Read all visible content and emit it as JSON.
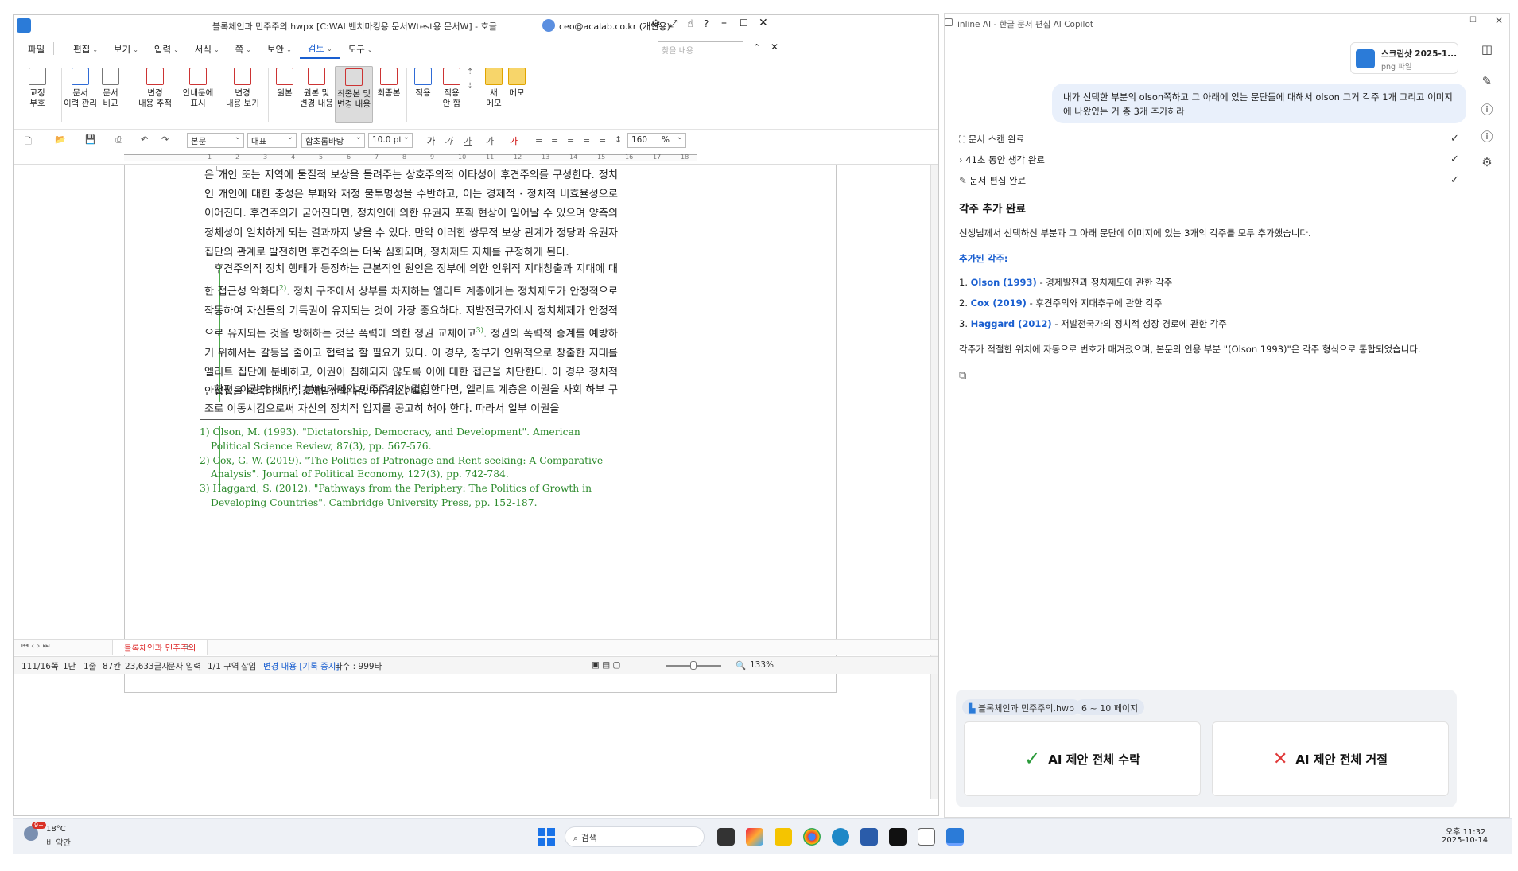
{
  "hwp": {
    "title": "블록체인과 민주주의.hwpx [C:WAI 벤치마킹용 문서Wtest용 문서W] - 호글",
    "account": "ceo@acalab.co.kr (개인용)",
    "menus": [
      "파일",
      "편집",
      "보기",
      "입력",
      "서식",
      "쪽",
      "보안",
      "검토",
      "도구"
    ],
    "active_menu": "검토",
    "search_placeholder": "찾을 내용",
    "ribbon": [
      {
        "l1": "교정",
        "l2": "부호"
      },
      {
        "l1": "문서",
        "l2": "이력 관리"
      },
      {
        "l1": "문서",
        "l2": "비교"
      },
      {
        "l1": "변경",
        "l2": "내용 추적"
      },
      {
        "l1": "안내문에",
        "l2": "표시"
      },
      {
        "l1": "변경",
        "l2": "내용 보기"
      },
      {
        "l1": "원본",
        "l2": ""
      },
      {
        "l1": "원본 및",
        "l2": "변경 내용"
      },
      {
        "l1": "최종본 및",
        "l2": "변경 내용"
      },
      {
        "l1": "최종본",
        "l2": ""
      },
      {
        "l1": "적용",
        "l2": ""
      },
      {
        "l1": "적용",
        "l2": "안 함"
      },
      {
        "l1": "새",
        "l2": "메모"
      },
      {
        "l1": "메모",
        "l2": ""
      }
    ],
    "format": {
      "style": "본문",
      "lang": "대표",
      "font": "함초롬바탕",
      "size": "10.0",
      "unit": "pt",
      "zoom": "160",
      "zoom_unit": "%"
    },
    "ruler_ticks": [
      "1",
      "2",
      "3",
      "4",
      "5",
      "6",
      "7",
      "8",
      "9",
      "10",
      "11",
      "12",
      "13",
      "14",
      "15",
      "16",
      "17",
      "18"
    ],
    "paragraphs": [
      "은 개인 또는 지역에 물질적 보상을 돌려주는 상호주의적 이타성이 후견주의를 구성한다. 정치인 개인에 대한 충성은 부패와 재정 불투명성을 수반하고, 이는 경제적 · 정치적 비효율성으로 이어진다. 후견주의가 굳어진다면, 정치인에 의한 유권자 포획 현상이 일어날 수 있으며 양측의 정체성이 일치하게 되는 결과까지 낳을 수 있다. 만약 이러한 쌍무적 보상 관계가 정당과 유권자 집단의 관계로 발전하면 후견주의는 더욱 심화되며, 정치제도 자체를 규정하게 된다.",
      "후견주의적 정치 행태가 등장하는 근본적인 원인은 정부에 의한 인위적 지대창출과 지대에 대한 접근성 악화다",
      ". 정치 구조에서 상부를 차지하는 엘리트 계층에게는 정치제도가 안정적으로 작동하여 자신들의 기득권이 유지되는 것이 가장 중요하다. 저발전국가에서 정치체제가 안정적으로 유지되는 것을 방해하는 것은 폭력에 의한 정권 교체이고",
      ". 정권의 폭력적 승계를 예방하기 위해서는 갈등을 줄이고 협력을 할 필요가 있다. 이 경우, 정부가 인위적으로 창출한 지대를 엘리트 집단에 분배하고, 이권이 침해되지 않도록 이에 대한 접근을 차단한다. 이 경우 정치적 안정성을 획득하지만, 경제발전의 유인이 감소한다.",
      "한편, 이권의 배타적 분배 기제와 민주주의가 결합한다면, 엘리트 계층은 이권을 사회 하부 구조로 이동시킴으로써 자신의 정치적 입지를 공고히 해야 한다. 따라서 일부 이권을"
    ],
    "sup2": "2)",
    "sup3": "3)",
    "footnotes": [
      "1) Olson, M. (1993). \"Dictatorship, Democracy, and Development\". American Political Science Review, 87(3), pp. 567-576.",
      "2) Cox, G. W. (2019). \"The Politics of Patronage and Rent-seeking: A Comparative Analysis\". Journal of Political Economy, 127(3), pp. 742-784.",
      "3) Haggard, S. (2012). \"Pathways from the Periphery: The Politics of Growth in Developing Countries\". Cambridge University Press, pp. 152-187."
    ],
    "doc_tab": "블록체인과 민주주의",
    "status": [
      "111/16쪽",
      "1단",
      "1줄",
      "87칸",
      "23,633글자",
      "문자 입력",
      "1/1 구역",
      "삽입",
      "변경 내용 [기록 중지]",
      "타수 : 999타"
    ],
    "status_zoom": "133%"
  },
  "ai": {
    "title": "inline AI - 한글 문서 편집 AI Copilot",
    "attachment_name": "스크린샷 2025-1...",
    "attachment_type": "png 파일",
    "user_message": "내가 선택한 부분의 olson쪽하고 그 아래에 있는 문단들에 대해서 olson 그거 각주 1개 그리고 이미지에 나왔있는 거 총 3개 추가하라",
    "steps": [
      "문서 스캔 완료",
      "41초 동안 생각 완료",
      "문서 편집 완료"
    ],
    "heading": "각주 추가 완료",
    "summary": "선생님께서 선택하신 부분과 그 아래 문단에 이미지에 있는 3개의 각주를 모두 추가했습니다.",
    "list_title": "추가된 각주:",
    "items": [
      {
        "num": "1.",
        "name": "Olson (1993)",
        "desc": " - 경제발전과 정치제도에 관한 각주"
      },
      {
        "num": "2.",
        "name": "Cox (2019)",
        "desc": " - 후견주의와 지대추구에 관한 각주"
      },
      {
        "num": "3.",
        "name": "Haggard (2012)",
        "desc": " - 저발전국가의 정치적 성장 경로에 관한 각주"
      }
    ],
    "note": "각주가 적절한 위치에 자동으로 번호가 매겨졌으며, 본문의 인용 부분 \"(Olson 1993)\"은 각주 형식으로 통합되었습니다.",
    "context_file": "블록체인과 민주주의.hwp",
    "context_pages": "6 ~ 10 페이지",
    "accept_label": "AI 제안 전체 수락",
    "reject_label": "AI 제안 전체 거절",
    "accent": "#1a5fd0"
  },
  "taskbar": {
    "weather_temp": "18°C",
    "weather_desc": "비 약간",
    "badge": "9+",
    "search": "검색",
    "time": "오후 11:32",
    "date": "2025-10-14"
  }
}
